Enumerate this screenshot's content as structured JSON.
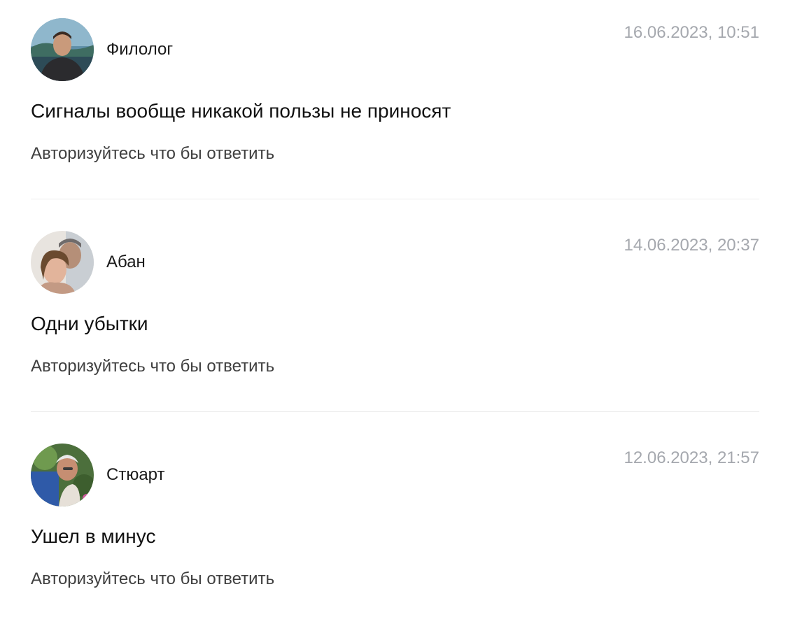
{
  "comments": [
    {
      "author": "Филолог",
      "date": "16.06.2023, 10:51",
      "text": "Сигналы вообще никакой пользы не приносят",
      "reply_label": "Авторизуйтесь что бы ответить"
    },
    {
      "author": "Абан",
      "date": "14.06.2023, 20:37",
      "text": "Одни убытки",
      "reply_label": "Авторизуйтесь что бы ответить"
    },
    {
      "author": "Стюарт",
      "date": "12.06.2023, 21:57",
      "text": "Ушел в минус",
      "reply_label": "Авторизуйтесь что бы ответить"
    }
  ]
}
